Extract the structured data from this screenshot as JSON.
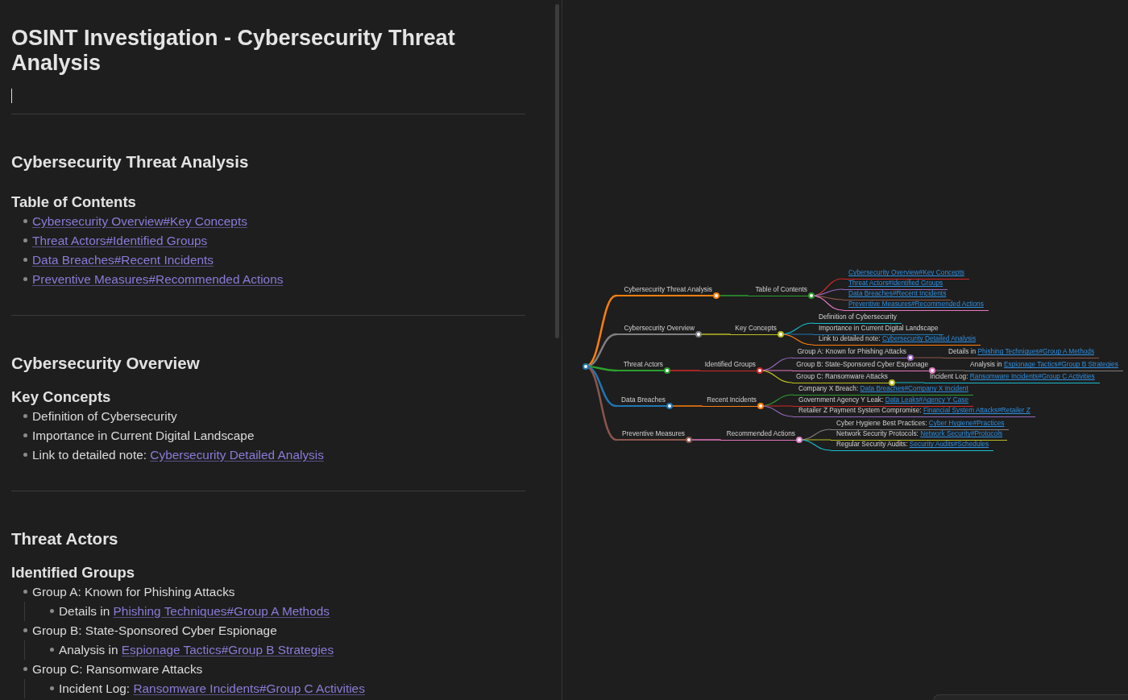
{
  "note": {
    "title": "OSINT Investigation - Cybersecurity Threat Analysis",
    "cursor": true,
    "sections": [
      {
        "heading": "Cybersecurity Threat Analysis",
        "subheading": "Table of Contents",
        "items": [
          {
            "link": "Cybersecurity Overview#Key Concepts"
          },
          {
            "link": "Threat Actors#Identified Groups"
          },
          {
            "link": "Data Breaches#Recent Incidents"
          },
          {
            "link": "Preventive Measures#Recommended Actions"
          }
        ]
      },
      {
        "heading": "Cybersecurity Overview",
        "subheading": "Key Concepts",
        "items": [
          {
            "text": "Definition of Cybersecurity"
          },
          {
            "text": "Importance in Current Digital Landscape"
          },
          {
            "text": "Link to detailed note:",
            "link": "Cybersecurity Detailed Analysis"
          }
        ]
      },
      {
        "heading": "Threat Actors",
        "subheading": "Identified Groups",
        "items": [
          {
            "text": "Group A: Known for Phishing Attacks",
            "children": [
              {
                "text": "Details in",
                "link": "Phishing Techniques#Group A Methods"
              }
            ]
          },
          {
            "text": "Group B: State-Sponsored Cyber Espionage",
            "children": [
              {
                "text": "Analysis in",
                "link": "Espionage Tactics#Group B Strategies"
              }
            ]
          },
          {
            "text": "Group C: Ransomware Attacks",
            "children": [
              {
                "text": "Incident Log:",
                "link": "Ransomware Incidents#Group C Activities"
              }
            ]
          }
        ]
      }
    ]
  },
  "mindmap": {
    "color": "#1f77b4",
    "children": [
      {
        "text": "Cybersecurity Threat Analysis",
        "color": "#ff7f0e",
        "children": [
          {
            "text": "Table of Contents",
            "color": "#2ca02c",
            "children": [
              {
                "link": "Cybersecurity Overview#Key Concepts",
                "color": "#d62728"
              },
              {
                "link": "Threat Actors#Identified Groups",
                "color": "#9467bd"
              },
              {
                "link": "Data Breaches#Recent Incidents",
                "color": "#8c564b"
              },
              {
                "link": "Preventive Measures#Recommended Actions",
                "color": "#e377c2"
              }
            ]
          }
        ]
      },
      {
        "text": "Cybersecurity Overview",
        "color": "#7f7f7f",
        "children": [
          {
            "text": "Key Concepts",
            "color": "#bcbd22",
            "children": [
              {
                "text": "Definition of Cybersecurity",
                "color": "#17becf"
              },
              {
                "text": "Importance in Current Digital Landscape",
                "color": "#1f77b4"
              },
              {
                "text": "Link to detailed note:",
                "link": "Cybersecurity Detailed Analysis",
                "color": "#ff7f0e"
              }
            ]
          }
        ]
      },
      {
        "text": "Threat Actors",
        "color": "#2ca02c",
        "children": [
          {
            "text": "Identified Groups",
            "color": "#d62728",
            "children": [
              {
                "text": "Group A: Known for Phishing Attacks",
                "color": "#9467bd",
                "children": [
                  {
                    "text": "Details in",
                    "link": "Phishing Techniques#Group A Methods",
                    "color": "#8c564b"
                  }
                ]
              },
              {
                "text": "Group B: State-Sponsored Cyber Espionage",
                "color": "#e377c2",
                "children": [
                  {
                    "text": "Analysis in",
                    "link": "Espionage Tactics#Group B Strategies",
                    "color": "#7f7f7f"
                  }
                ]
              },
              {
                "text": "Group C: Ransomware Attacks",
                "color": "#bcbd22",
                "children": [
                  {
                    "text": "Incident Log:",
                    "link": "Ransomware Incidents#Group C Activities",
                    "color": "#17becf"
                  }
                ]
              }
            ]
          }
        ]
      },
      {
        "text": "Data Breaches",
        "color": "#1f77b4",
        "children": [
          {
            "text": "Recent Incidents",
            "color": "#ff7f0e",
            "children": [
              {
                "text": "Company X Breach:",
                "link": "Data Breaches#Company X Incident",
                "color": "#2ca02c"
              },
              {
                "text": "Government Agency Y Leak:",
                "link": "Data Leaks#Agency Y Case",
                "color": "#d62728"
              },
              {
                "text": "Retailer Z Payment System Compromise:",
                "link": "Financial System Attacks#Retailer Z",
                "color": "#9467bd"
              }
            ]
          }
        ]
      },
      {
        "text": "Preventive Measures",
        "color": "#8c564b",
        "children": [
          {
            "text": "Recommended Actions",
            "color": "#e377c2",
            "children": [
              {
                "text": "Cyber Hygiene Best Practices:",
                "link": "Cyber Hygiene#Practices",
                "color": "#7f7f7f"
              },
              {
                "text": "Network Security Protocols:",
                "link": "Network Security#Protocols",
                "color": "#bcbd22"
              },
              {
                "text": "Regular Security Audits:",
                "link": "Security Audits#Schedules",
                "color": "#17becf"
              }
            ]
          }
        ]
      }
    ]
  }
}
